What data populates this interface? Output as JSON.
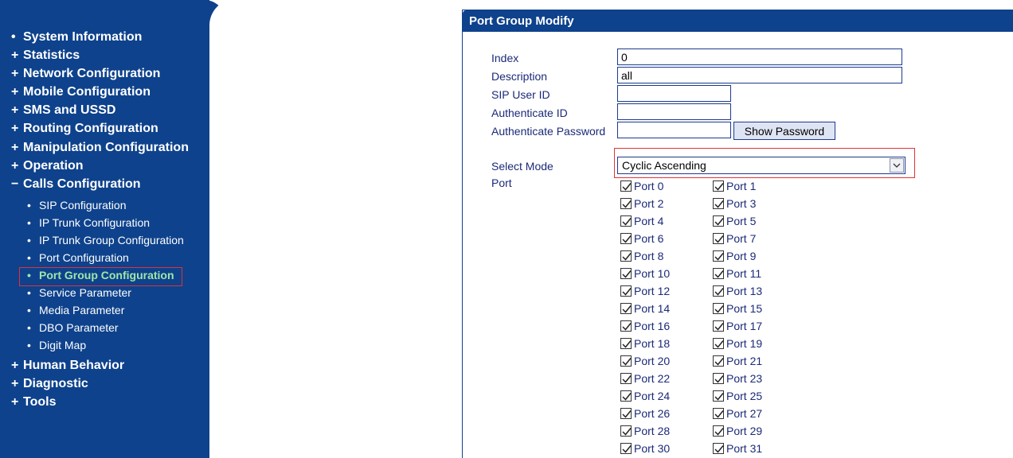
{
  "sidebar": {
    "items": [
      {
        "mark": "•",
        "label": "System Information"
      },
      {
        "mark": "+",
        "label": "Statistics"
      },
      {
        "mark": "+",
        "label": "Network Configuration"
      },
      {
        "mark": "+",
        "label": "Mobile Configuration"
      },
      {
        "mark": "+",
        "label": "SMS and USSD"
      },
      {
        "mark": "+",
        "label": "Routing Configuration"
      },
      {
        "mark": "+",
        "label": "Manipulation Configuration"
      },
      {
        "mark": "+",
        "label": "Operation"
      },
      {
        "mark": "−",
        "label": "Calls Configuration"
      },
      {
        "mark": "+",
        "label": "Human Behavior"
      },
      {
        "mark": "+",
        "label": "Diagnostic"
      },
      {
        "mark": "+",
        "label": "Tools"
      }
    ],
    "calls_sub": [
      {
        "label": "SIP Configuration"
      },
      {
        "label": "IP Trunk Configuration"
      },
      {
        "label": "IP Trunk Group Configuration"
      },
      {
        "label": "Port Configuration"
      },
      {
        "label": "Port Group Configuration",
        "active": true
      },
      {
        "label": "Service Parameter"
      },
      {
        "label": "Media Parameter"
      },
      {
        "label": "DBO Parameter"
      },
      {
        "label": "Digit Map"
      }
    ]
  },
  "panel": {
    "title": "Port Group Modify",
    "labels": {
      "index": "Index",
      "description": "Description",
      "sip_user_id": "SIP User ID",
      "authenticate_id": "Authenticate ID",
      "authenticate_password": "Authenticate Password",
      "select_mode": "Select Mode",
      "port": "Port"
    },
    "values": {
      "index": "0",
      "description": "all",
      "sip_user_id": "",
      "authenticate_id": "",
      "authenticate_password": ""
    },
    "show_password_label": "Show Password",
    "select_mode_value": "Cyclic Ascending",
    "ports": [
      "Port 0",
      "Port 1",
      "Port 2",
      "Port 3",
      "Port 4",
      "Port 5",
      "Port 6",
      "Port 7",
      "Port 8",
      "Port 9",
      "Port 10",
      "Port 11",
      "Port 12",
      "Port 13",
      "Port 14",
      "Port 15",
      "Port 16",
      "Port 17",
      "Port 18",
      "Port 19",
      "Port 20",
      "Port 21",
      "Port 22",
      "Port 23",
      "Port 24",
      "Port 25",
      "Port 26",
      "Port 27",
      "Port 28",
      "Port 29",
      "Port 30",
      "Port 31"
    ],
    "ports_checked": true
  },
  "colors": {
    "sidebar_bg": "#0e428c",
    "text_blue": "#1b2a78",
    "active_green": "#9ee6a8",
    "highlight_red": "#e0323a"
  }
}
